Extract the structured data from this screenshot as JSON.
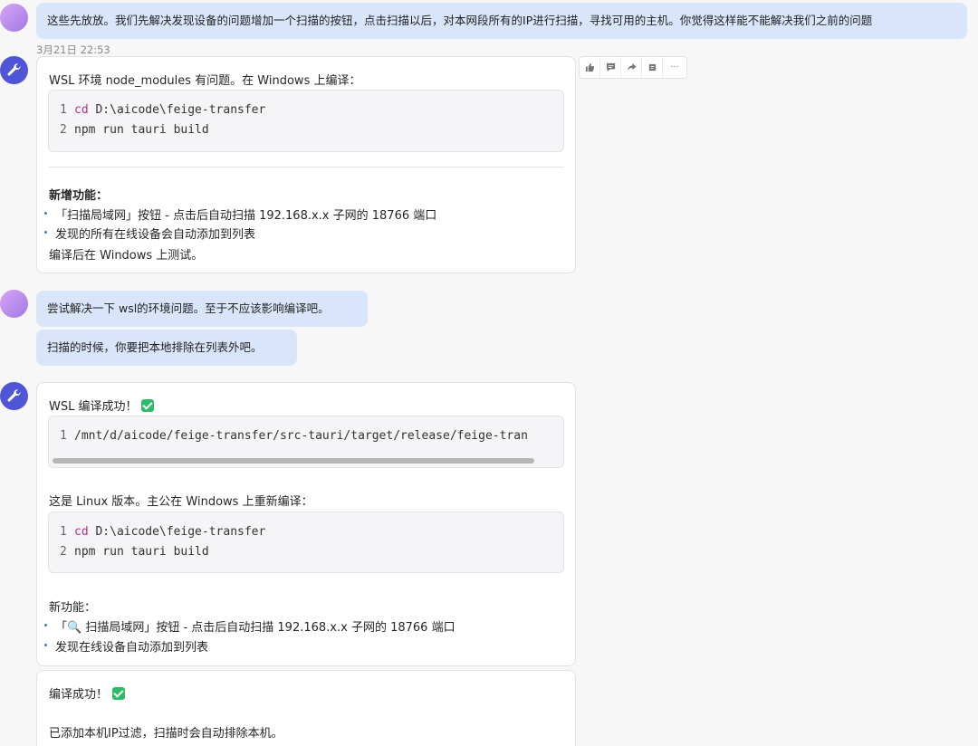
{
  "msg1": {
    "text": "这些先放放。我们先解决发现设备的问题增加一个扫描的按钮，点击扫描以后，对本网段所有的IP进行扫描，寻找可用的主机。你觉得这样能不能解决我们之前的问题",
    "time": "3月21日 22:53"
  },
  "actions": {
    "thumbs_up": "thumbs-up-icon",
    "comment": "comment-icon",
    "share": "share-icon",
    "copy": "copy-icon",
    "more": "···"
  },
  "reply1": {
    "intro": "WSL 环境 node_modules 有问题。在 Windows 上编译：",
    "code": [
      {
        "n": "1",
        "kw": "cd",
        "rest": " D:\\aicode\\feige-transfer"
      },
      {
        "n": "2",
        "kw": "",
        "rest": "npm run tauri build"
      }
    ],
    "heading": "新增功能：",
    "bullets": [
      "「扫描局域网」按钮 - 点击后自动扫描 192.168.x.x 子网的 18766 端口",
      "发现的所有在线设备会自动添加到列表"
    ],
    "footer": "编译后在 Windows 上测试。"
  },
  "msg2": {
    "text1": "尝试解决一下 wsl的环境问题。至于不应该影响编译吧。",
    "text2": "扫描的时候，你要把本地排除在列表外吧。"
  },
  "reply2": {
    "title": "WSL 编译成功！",
    "path_code": {
      "n": "1",
      "text": "/mnt/d/aicode/feige-transfer/src-tauri/target/release/feige-tran"
    },
    "note": "这是 Linux 版本。主公在 Windows 上重新编译：",
    "code": [
      {
        "n": "1",
        "kw": "cd",
        "rest": " D:\\aicode\\feige-transfer"
      },
      {
        "n": "2",
        "kw": "",
        "rest": "npm run tauri build"
      }
    ],
    "heading": "新功能：",
    "bullets": [
      "「🔍 扫描局域网」按钮 - 点击后自动扫描 192.168.x.x 子网的 18766 端口",
      "发现在线设备自动添加到列表"
    ]
  },
  "reply3": {
    "title": "编译成功！",
    "text": "已添加本机IP过滤，扫描时会自动排除本机。"
  },
  "colors": {
    "user_bubble": "#d9e5fb",
    "bot_avatar": "#4f55d6",
    "keyword": "#b3308a",
    "check": "#2dbb67"
  }
}
